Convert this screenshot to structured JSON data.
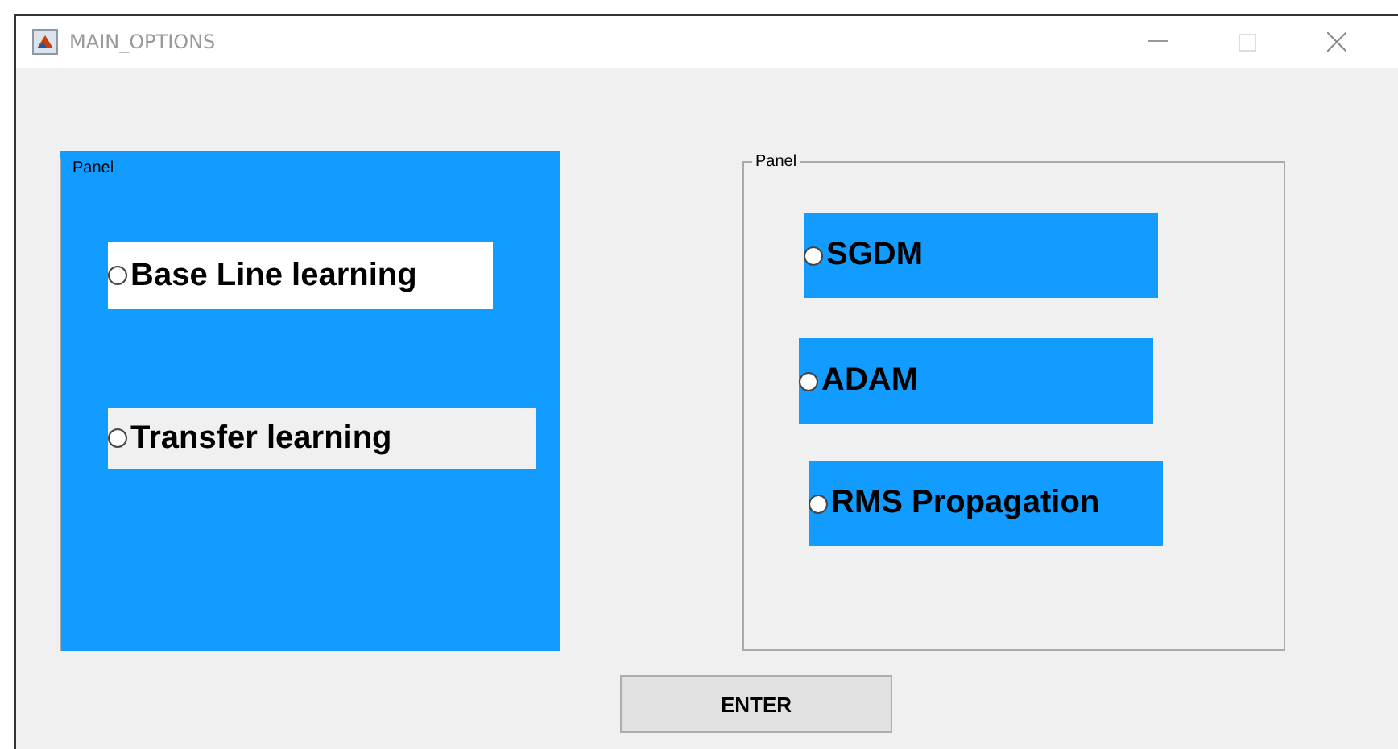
{
  "window": {
    "title": "MAIN_OPTIONS"
  },
  "panels": [
    {
      "title": "Panel",
      "kind": "filled",
      "options": [
        {
          "label": "Base Line learning",
          "selected": false,
          "color": "#ffffff"
        },
        {
          "label": "Transfer learning",
          "selected": false,
          "color": "#f0f0f0"
        }
      ]
    },
    {
      "title": "Panel",
      "kind": "plain",
      "options": [
        {
          "label": "SGDM",
          "selected": false,
          "color": "#129cff"
        },
        {
          "label": "ADAM",
          "selected": false,
          "color": "#129cff"
        },
        {
          "label": "RMS Propagation",
          "selected": false,
          "color": "#129cff"
        }
      ]
    }
  ],
  "button": "ENTER"
}
